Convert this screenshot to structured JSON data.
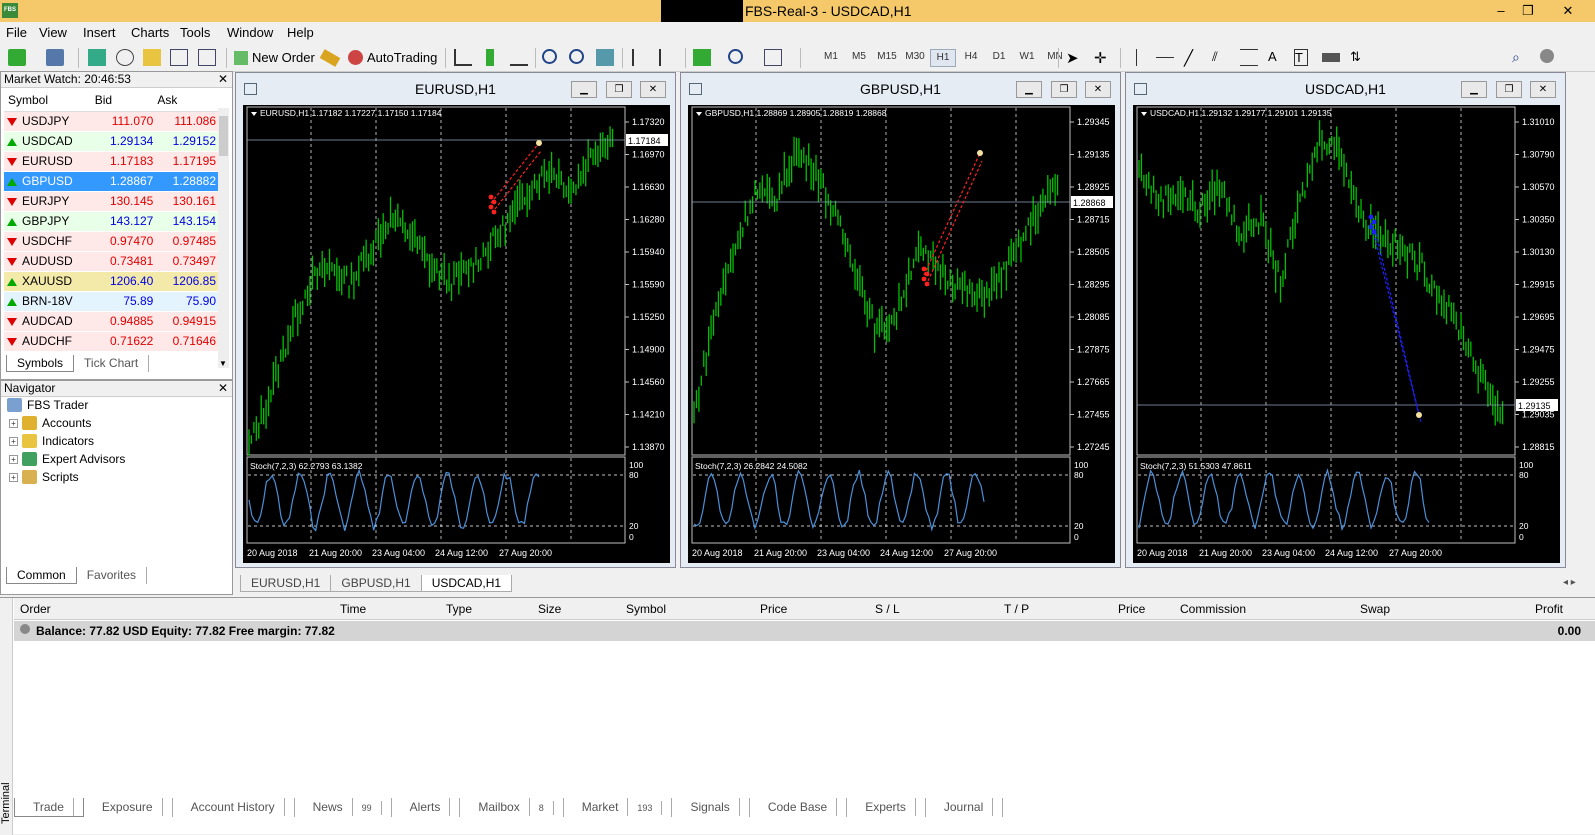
{
  "window": {
    "title": "FBS-Real-3 - USDCAD,H1",
    "logo": "FBS"
  },
  "menu": [
    "File",
    "View",
    "Insert",
    "Charts",
    "Tools",
    "Window",
    "Help"
  ],
  "toolbar": {
    "new_order": "New Order",
    "auto_trading": "AutoTrading",
    "timeframes": [
      "M1",
      "M5",
      "M15",
      "M30",
      "H1",
      "H4",
      "D1",
      "W1",
      "MN"
    ],
    "active_timeframe": "H1"
  },
  "market_watch": {
    "title": "Market Watch: 20:46:53",
    "columns": [
      "Symbol",
      "Bid",
      "Ask"
    ],
    "rows": [
      {
        "symbol": "USDJPY",
        "bid": "111.070",
        "ask": "111.086",
        "dir": "down"
      },
      {
        "symbol": "USDCAD",
        "bid": "1.29134",
        "ask": "1.29152",
        "dir": "up"
      },
      {
        "symbol": "EURUSD",
        "bid": "1.17183",
        "ask": "1.17195",
        "dir": "down"
      },
      {
        "symbol": "GBPUSD",
        "bid": "1.28867",
        "ask": "1.28882",
        "dir": "up"
      },
      {
        "symbol": "EURJPY",
        "bid": "130.145",
        "ask": "130.161",
        "dir": "down"
      },
      {
        "symbol": "GBPJPY",
        "bid": "143.127",
        "ask": "143.154",
        "dir": "up"
      },
      {
        "symbol": "USDCHF",
        "bid": "0.97470",
        "ask": "0.97485",
        "dir": "down"
      },
      {
        "symbol": "AUDUSD",
        "bid": "0.73481",
        "ask": "0.73497",
        "dir": "down"
      },
      {
        "symbol": "XAUUSD",
        "bid": "1206.40",
        "ask": "1206.85",
        "dir": "up"
      },
      {
        "symbol": "BRN-18V",
        "bid": "75.89",
        "ask": "75.90",
        "dir": "up"
      },
      {
        "symbol": "AUDCAD",
        "bid": "0.94885",
        "ask": "0.94915",
        "dir": "down"
      },
      {
        "symbol": "AUDCHF",
        "bid": "0.71622",
        "ask": "0.71646",
        "dir": "down"
      }
    ],
    "tabs": [
      "Symbols",
      "Tick Chart"
    ]
  },
  "navigator": {
    "title": "Navigator",
    "root": "FBS Trader",
    "items": [
      "Accounts",
      "Indicators",
      "Expert Advisors",
      "Scripts"
    ],
    "tabs": [
      "Common",
      "Favorites"
    ]
  },
  "charts": [
    {
      "title": "EURUSD,H1",
      "info": "EURUSD,H1  1.17182 1.17227 1.17150 1.17184",
      "price_ticks": [
        "1.17320",
        "1.16970",
        "1.16630",
        "1.16280",
        "1.15940",
        "1.15590",
        "1.15250",
        "1.14900",
        "1.14560",
        "1.14210",
        "1.13870"
      ],
      "current": "1.17184",
      "stoch": "Stoch(7,2,3) 62.2793 63.1382",
      "dates": [
        "20 Aug 2018",
        "21 Aug 20:00",
        "23 Aug 04:00",
        "24 Aug 12:00",
        "27 Aug 20:00"
      ]
    },
    {
      "title": "GBPUSD,H1",
      "info": "GBPUSD,H1  1.28869 1.28905 1.28819 1.28868",
      "price_ticks": [
        "1.29345",
        "1.29135",
        "1.28925",
        "1.28715",
        "1.28505",
        "1.28295",
        "1.28085",
        "1.27875",
        "1.27665",
        "1.27455",
        "1.27245"
      ],
      "current": "1.28868",
      "stoch": "Stoch(7,2,3) 26.2842 24.5082",
      "dates": [
        "20 Aug 2018",
        "21 Aug 20:00",
        "23 Aug 04:00",
        "24 Aug 12:00",
        "27 Aug 20:00"
      ]
    },
    {
      "title": "USDCAD,H1",
      "info": "USDCAD,H1  1.29132 1.29177 1.29101 1.29135",
      "price_ticks": [
        "1.31010",
        "1.30790",
        "1.30570",
        "1.30350",
        "1.30130",
        "1.29915",
        "1.29695",
        "1.29475",
        "1.29255",
        "1.29035",
        "1.28815"
      ],
      "current": "1.29135",
      "stoch": "Stoch(7,2,3) 51.5303 47.8611",
      "dates": [
        "20 Aug 2018",
        "21 Aug 20:00",
        "23 Aug 04:00",
        "24 Aug 12:00",
        "27 Aug 20:00"
      ]
    }
  ],
  "stoch_levels": [
    "100",
    "80",
    "20",
    "0"
  ],
  "chart_tabs": [
    "EURUSD,H1",
    "GBPUSD,H1",
    "USDCAD,H1"
  ],
  "terminal": {
    "columns": [
      "Order",
      "Time",
      "Type",
      "Size",
      "Symbol",
      "Price",
      "S / L",
      "T / P",
      "Price",
      "Commission",
      "Swap",
      "Profit"
    ],
    "balance": "Balance: 77.82 USD  Equity: 77.82  Free margin: 77.82",
    "profit": "0.00",
    "tabs": [
      {
        "label": "Trade",
        "badge": ""
      },
      {
        "label": "Exposure",
        "badge": ""
      },
      {
        "label": "Account History",
        "badge": ""
      },
      {
        "label": "News",
        "badge": "99"
      },
      {
        "label": "Alerts",
        "badge": ""
      },
      {
        "label": "Mailbox",
        "badge": "8"
      },
      {
        "label": "Market",
        "badge": "193"
      },
      {
        "label": "Signals",
        "badge": ""
      },
      {
        "label": "Code Base",
        "badge": ""
      },
      {
        "label": "Experts",
        "badge": ""
      },
      {
        "label": "Journal",
        "badge": ""
      }
    ],
    "side_label": "Terminal"
  },
  "colors": {
    "up_candle": "#00c000",
    "bid_down": "#e00000",
    "bid_up": "#0000e0",
    "stoch": "#4a90d9"
  }
}
